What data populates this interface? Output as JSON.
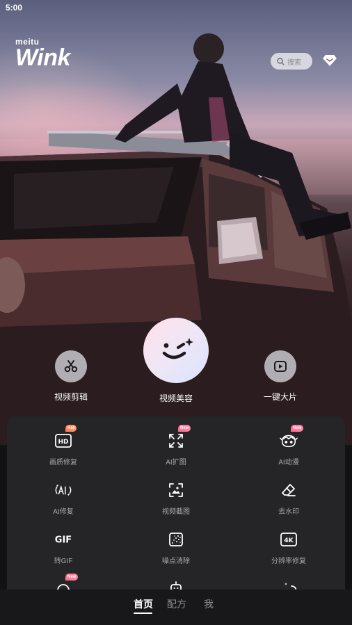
{
  "status_bar": {
    "time": "5:00"
  },
  "header": {
    "brand_small": "meitu",
    "brand_large": "Wink",
    "search_placeholder": "搜索"
  },
  "quick_actions": [
    {
      "label": "视频剪辑",
      "icon": "scissors-icon"
    },
    {
      "label": "视频美容",
      "icon": "wink-face-icon"
    },
    {
      "label": "一键大片",
      "icon": "play-square-icon"
    }
  ],
  "tools": [
    {
      "label": "画质修复",
      "icon": "hd-icon",
      "badge": "Hot"
    },
    {
      "label": "AI扩图",
      "icon": "expand-corners-icon",
      "badge": "New"
    },
    {
      "label": "AI动漫",
      "icon": "anime-face-icon",
      "badge": "New"
    },
    {
      "label": "AI修复",
      "icon": "ai-sparkle-icon",
      "badge": ""
    },
    {
      "label": "视频截图",
      "icon": "screenshot-icon",
      "badge": ""
    },
    {
      "label": "去水印",
      "icon": "eraser-icon",
      "badge": ""
    },
    {
      "label": "转GIF",
      "icon": "gif-icon",
      "badge": ""
    },
    {
      "label": "噪点消除",
      "icon": "noise-icon",
      "badge": ""
    },
    {
      "label": "分辨率修复",
      "icon": "4k-icon",
      "badge": ""
    },
    {
      "label": "",
      "icon": "face-bubble-icon",
      "badge": "New"
    },
    {
      "label": "",
      "icon": "robot-icon",
      "badge": ""
    },
    {
      "label": "",
      "icon": "sparkle-moon-icon",
      "badge": ""
    }
  ],
  "icon_text": {
    "hd": "HD",
    "gif": "GIF",
    "fourk": "4K"
  },
  "bottom_nav": {
    "tabs": [
      "首页",
      "配方",
      "我"
    ],
    "active": "首页"
  },
  "colors": {
    "panel": "#252527",
    "badge_new": "#ff6b8b",
    "badge_hot": "#ff7a55"
  }
}
